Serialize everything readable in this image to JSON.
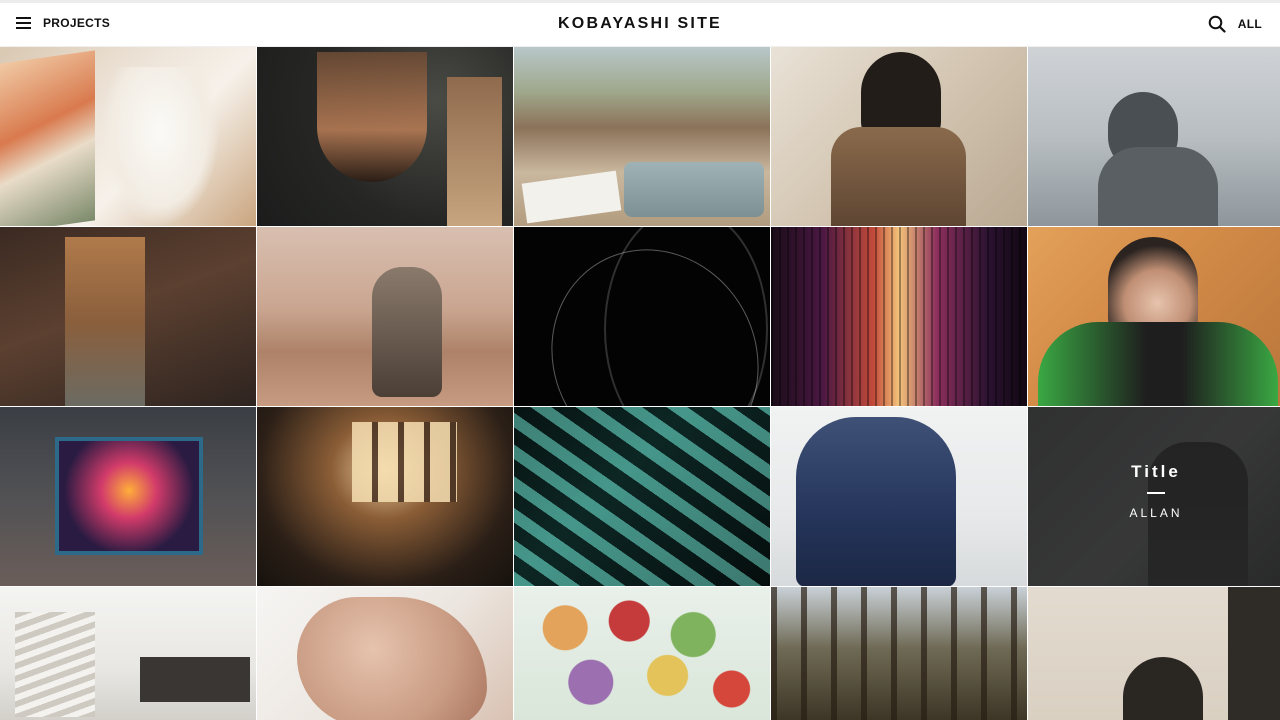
{
  "header": {
    "menu_label": "PROJECTS",
    "site_title": "KOBAYASHI SITE",
    "filter_label": "ALL",
    "icons": {
      "menu": "hamburger-icon",
      "search": "search-icon"
    }
  },
  "grid": {
    "columns": 5,
    "tiles": [
      {
        "subject": "woman-white-shirt-painting"
      },
      {
        "subject": "pour-over-coffee"
      },
      {
        "subject": "typewriter-on-table"
      },
      {
        "subject": "woman-blurred-face"
      },
      {
        "subject": "hooded-person-phone"
      },
      {
        "subject": "man-bicycle"
      },
      {
        "subject": "desert-figure"
      },
      {
        "subject": "abstract-white-lines"
      },
      {
        "subject": "neon-light-bars"
      },
      {
        "subject": "woman-green-sweater"
      },
      {
        "subject": "neon-sign-storefront"
      },
      {
        "subject": "dark-library-window"
      },
      {
        "subject": "teal-abstract-pattern"
      },
      {
        "subject": "woman-fur-coat"
      },
      {
        "subject": "couple-embrace"
      },
      {
        "subject": "white-interior-stairs"
      },
      {
        "subject": "tattooed-hand"
      },
      {
        "subject": "paper-lanterns"
      },
      {
        "subject": "forest-sunlight"
      },
      {
        "subject": "shadow-on-wall"
      }
    ],
    "hover_tile": {
      "index": 14,
      "title": "Title",
      "author": "ALLAN"
    }
  },
  "colors": {
    "header_bg": "#ffffff",
    "text": "#111111",
    "overlay_text": "#ffffff"
  }
}
